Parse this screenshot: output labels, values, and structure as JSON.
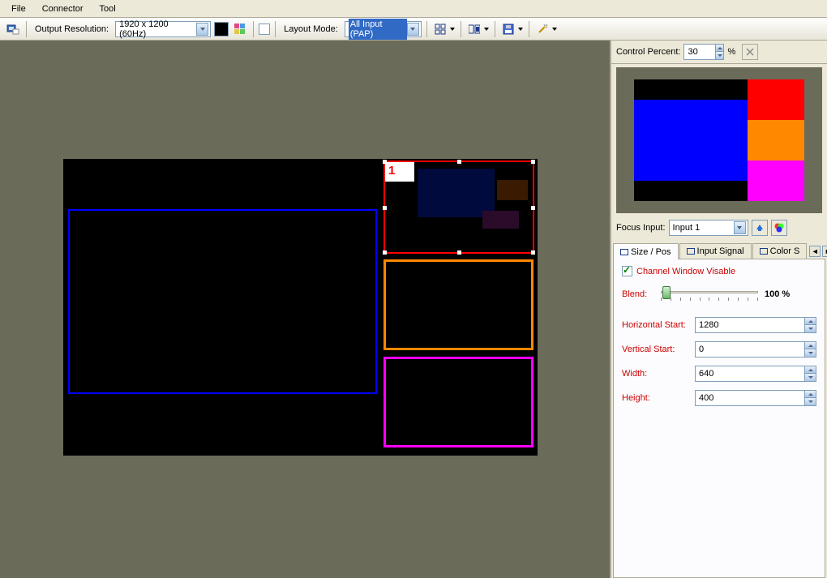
{
  "menu": {
    "file": "File",
    "connector": "Connector",
    "tool": "Tool"
  },
  "toolbar": {
    "output_res_label": "Output Resolution:",
    "output_res_value": "1920 x 1200 (60Hz)",
    "layout_mode_label": "Layout Mode:",
    "layout_mode_value": "All Input (PAP)"
  },
  "side": {
    "control_percent_label": "Control Percent:",
    "control_percent_value": "30",
    "percent_sign": "%",
    "focus_input_label": "Focus Input:",
    "focus_input_value": "Input 1",
    "tabs": {
      "size_pos": "Size / Pos",
      "input_signal": "Input Signal",
      "color": "Color S"
    },
    "channel_visible": "Channel Window Visable",
    "blend_label": "Blend:",
    "blend_value": "100 %",
    "h_start_label": "Horizontal Start:",
    "h_start_value": "1280",
    "v_start_label": "Vertical Start:",
    "v_start_value": "0",
    "width_label": "Width:",
    "width_value": "640",
    "height_label": "Height:",
    "height_value": "400"
  },
  "canvas": {
    "selected_label": "1"
  }
}
